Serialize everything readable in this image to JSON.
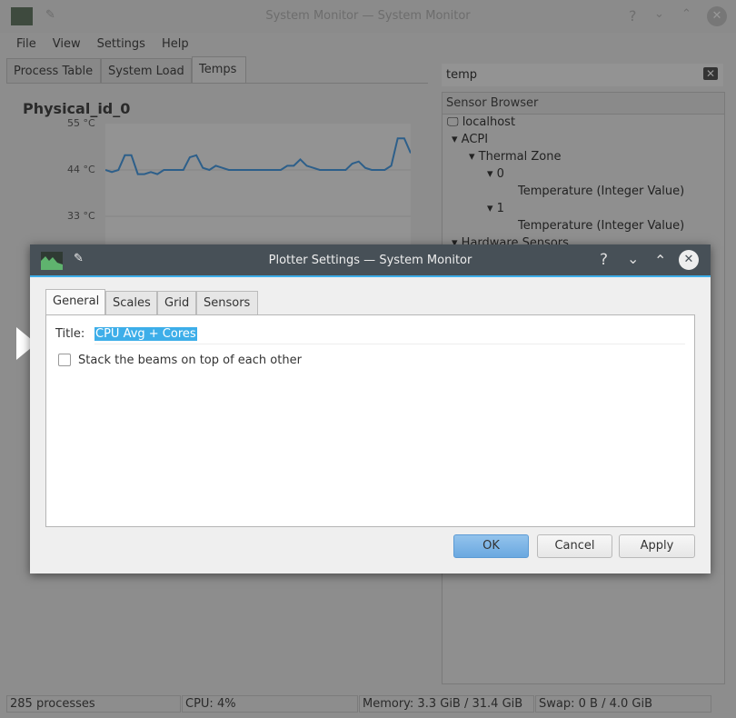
{
  "window": {
    "title": "System Monitor — System Monitor"
  },
  "menu": [
    "File",
    "View",
    "Settings",
    "Help"
  ],
  "tabs": [
    "Process Table",
    "System Load",
    "Temps"
  ],
  "plot": {
    "title": "Physical_id_0",
    "y_ticks": [
      "55 °C",
      "44 °C",
      "33 °C"
    ],
    "series": [
      44,
      43.5,
      44,
      47.5,
      47.5,
      43,
      43,
      43.5,
      43,
      44,
      44,
      44,
      44,
      47,
      47.5,
      44.5,
      44,
      45,
      44.5,
      44,
      44,
      44,
      44,
      44,
      44,
      44,
      44,
      44,
      45,
      45,
      46.5,
      45,
      44.5,
      44,
      44,
      44,
      44,
      44,
      45.5,
      46,
      44.5,
      44,
      44,
      44,
      45,
      51.5,
      51.5,
      48
    ]
  },
  "search": {
    "value": "temp"
  },
  "sensor_browser": {
    "header": "Sensor Browser",
    "items": [
      "localhost",
      "ACPI",
      "Thermal Zone",
      "0",
      "Temperature (Integer Value)",
      "1",
      "Temperature (Integer Value)",
      "Hardware Sensors"
    ]
  },
  "status": {
    "processes": "285 processes",
    "cpu": "CPU: 4%",
    "memory": "Memory: 3.3 GiB / 31.4 GiB",
    "swap": "Swap: 0 B / 4.0 GiB"
  },
  "dialog": {
    "title": "Plotter Settings — System Monitor",
    "tabs": [
      "General",
      "Scales",
      "Grid",
      "Sensors"
    ],
    "title_label": "Title:",
    "title_value": "CPU Avg + Cores",
    "stack_label": "Stack the beams on top of each other",
    "stack_checked": false,
    "ok": "OK",
    "cancel": "Cancel",
    "apply": "Apply"
  },
  "colors": {
    "accent": "#3daee9",
    "plot_line": "#2d5f8a",
    "titlebar": "#475057"
  }
}
